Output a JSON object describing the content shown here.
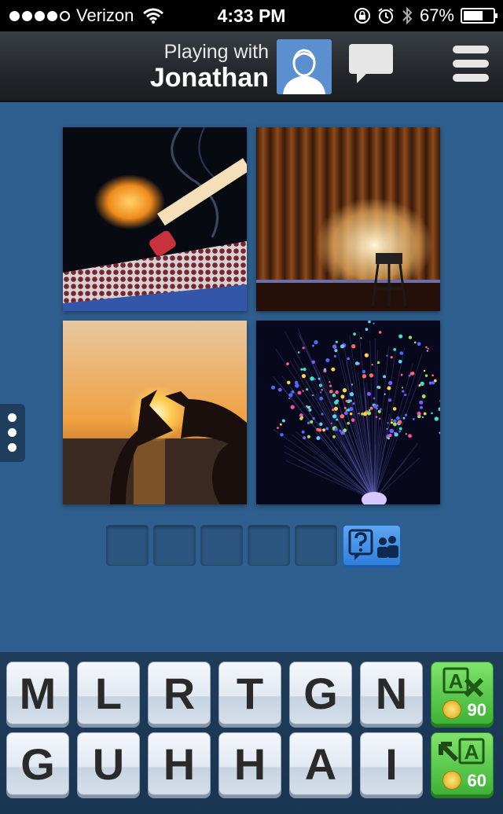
{
  "status_bar": {
    "carrier": "Verizon",
    "time": "4:33 PM",
    "battery": "67%",
    "battery_level": 0.67,
    "signal_dots_filled": 4,
    "signal_dots_total": 5
  },
  "header": {
    "subtitle": "Playing with",
    "opponent": "Jonathan"
  },
  "puzzle": {
    "images": [
      "match-fire-image",
      "stage-curtain-image",
      "sunset-hands-image",
      "fiber-optic-image"
    ],
    "answer_length": 5,
    "answer_slots": [
      "",
      "",
      "",
      "",
      ""
    ]
  },
  "letters": {
    "row1": [
      "M",
      "L",
      "R",
      "T",
      "G",
      "N"
    ],
    "row2": [
      "G",
      "U",
      "H",
      "H",
      "A",
      "I"
    ]
  },
  "powerups": {
    "remove_letters_cost": "90",
    "reveal_letter_cost": "60"
  },
  "colors": {
    "background": "#2f5f8f",
    "powerup_green": "#3fb238",
    "help_blue": "#2f7fdb"
  }
}
